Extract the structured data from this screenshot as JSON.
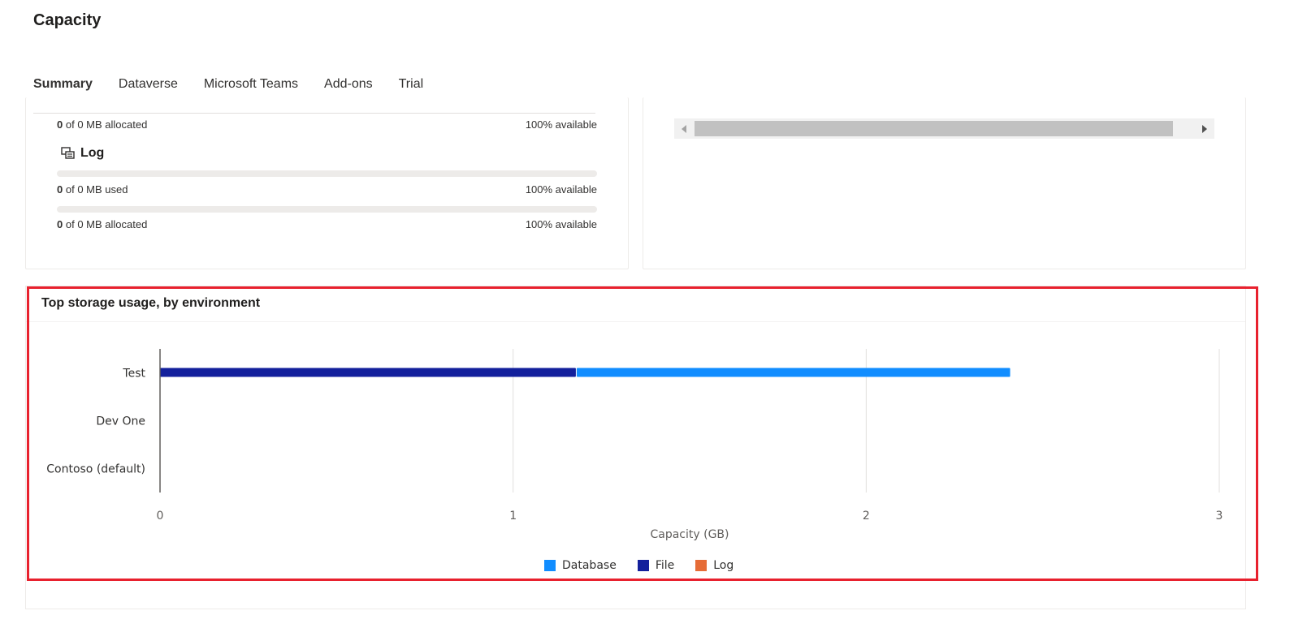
{
  "page": {
    "title": "Capacity"
  },
  "tabs": [
    {
      "label": "Summary",
      "active": true
    },
    {
      "label": "Dataverse",
      "active": false
    },
    {
      "label": "Microsoft Teams",
      "active": false
    },
    {
      "label": "Add-ons",
      "active": false
    },
    {
      "label": "Trial",
      "active": false
    }
  ],
  "left_card": {
    "file_allocated": {
      "value": "0",
      "suffix": "of 0 MB allocated",
      "available": "100% available",
      "progress": 0
    },
    "log": {
      "title": "Log",
      "icon": "log-icon",
      "used": {
        "value": "0",
        "suffix": "of 0 MB used",
        "available": "100% available",
        "progress": 0
      },
      "allocated": {
        "value": "0",
        "suffix": "of 0 MB allocated",
        "available": "100% available",
        "progress": 0
      }
    }
  },
  "right_card": {
    "scrollbar": {
      "left_icon": "scroll-left-icon",
      "right_icon": "scroll-right-icon"
    }
  },
  "chart_panel": {
    "title": "Top storage usage, by environment"
  },
  "chart_data": {
    "type": "bar",
    "orientation": "horizontal",
    "stacked": true,
    "categories": [
      "Test",
      "Dev One",
      "Contoso (default)"
    ],
    "series": [
      {
        "name": "File",
        "color": "#13209c",
        "values": [
          1.18,
          0,
          0
        ]
      },
      {
        "name": "Database",
        "color": "#118dff",
        "values": [
          1.23,
          0,
          0
        ]
      },
      {
        "name": "Log",
        "color": "#e66c37",
        "values": [
          0,
          0,
          0
        ]
      }
    ],
    "legend_order": [
      "Database",
      "File",
      "Log"
    ],
    "xlabel": "Capacity (GB)",
    "xlim": [
      0,
      3
    ],
    "xticks": [
      "0",
      "1",
      "2",
      "3"
    ],
    "grid": true,
    "legend_position": "bottom"
  },
  "colors": {
    "accent": "#742774",
    "highlight": "#e8212e"
  }
}
